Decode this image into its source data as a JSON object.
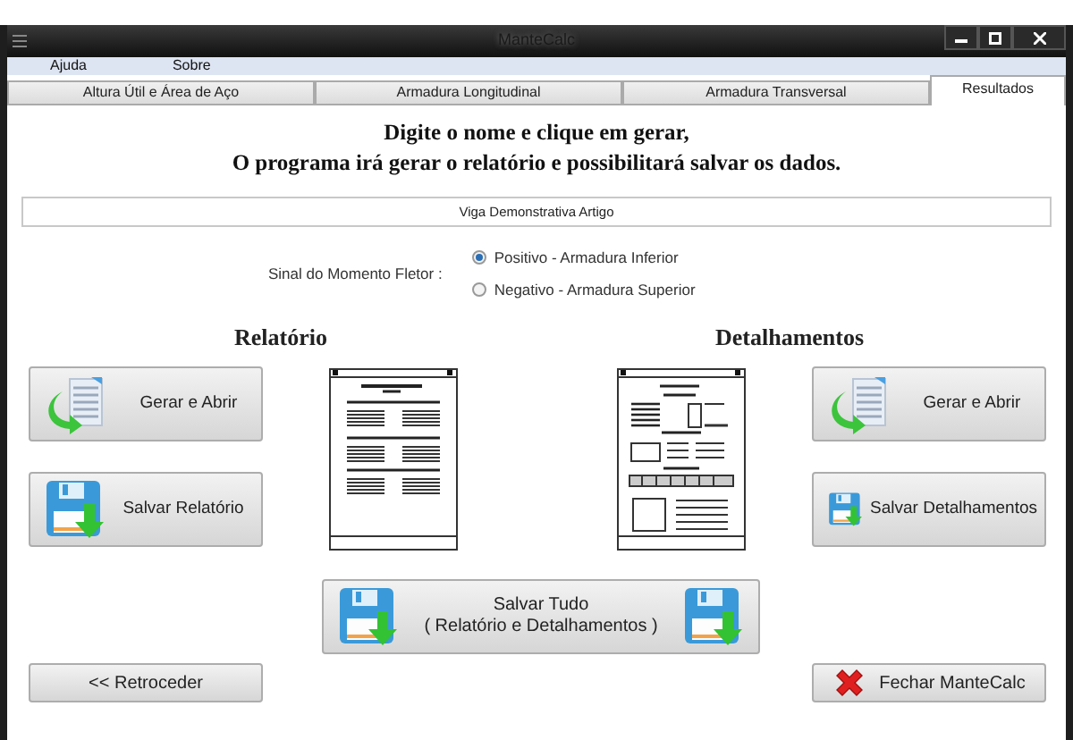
{
  "window": {
    "title": "ManteCalc"
  },
  "menu": [
    "Ajuda",
    "Sobre"
  ],
  "tabs": [
    {
      "label": "Altura Útil e Área de Aço",
      "selected": false
    },
    {
      "label": "Armadura Longitudinal",
      "selected": false
    },
    {
      "label": "Armadura Transversal",
      "selected": false
    },
    {
      "label": "Resultados",
      "selected": true
    }
  ],
  "instructions": [
    "Digite o nome e clique em gerar,",
    "O programa irá gerar o relatório e possibilitará salvar os dados."
  ],
  "name_field": {
    "value": "Viga Demonstrativa Artigo"
  },
  "moment_sign": {
    "label": "Sinal do Momento Fletor :",
    "options": [
      {
        "label": "Positivo - Armadura Inferior",
        "selected": true
      },
      {
        "label": "Negativo - Armadura Superior",
        "selected": false
      }
    ]
  },
  "sections": [
    {
      "title": "Relatório",
      "kind": "report",
      "buttons": [
        {
          "label": "Gerar e Abrir",
          "kind": "generate"
        },
        {
          "label": "Salvar Relatório",
          "kind": "save"
        }
      ]
    },
    {
      "title": "Detalhamentos",
      "kind": "detail",
      "buttons": [
        {
          "label": "Gerar e Abrir",
          "kind": "generate"
        },
        {
          "label": "Salvar Detalhamentos",
          "kind": "save"
        }
      ]
    }
  ],
  "save_all": {
    "lines": [
      "Salvar Tudo",
      "( Relatório e Detalhamentos )"
    ]
  },
  "footer_buttons": [
    {
      "label": "<< Retroceder",
      "kind": "plain"
    },
    {
      "label": "Fechar ManteCalc",
      "kind": "close"
    }
  ]
}
